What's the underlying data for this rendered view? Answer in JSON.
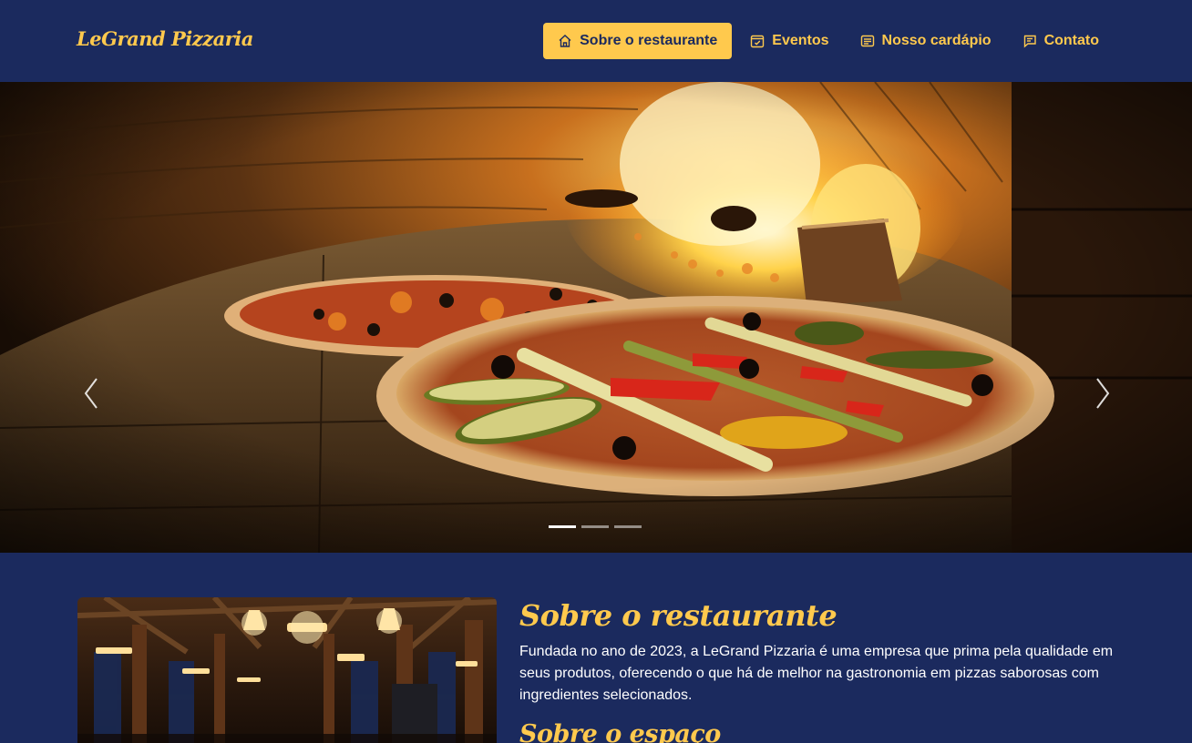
{
  "brand": "LeGrand Pizzaria",
  "nav": {
    "items": [
      {
        "label": "Sobre o restaurante",
        "icon": "home-icon",
        "active": true
      },
      {
        "label": "Eventos",
        "icon": "calendar-check-icon",
        "active": false
      },
      {
        "label": "Nosso cardápio",
        "icon": "menu-card-icon",
        "active": false
      },
      {
        "label": "Contato",
        "icon": "chat-icon",
        "active": false
      }
    ]
  },
  "carousel": {
    "slide_description": "Pizzas in wood-fired oven",
    "slide_count": 3,
    "active_slide": 1
  },
  "about": {
    "title": "Sobre o restaurante",
    "text": "Fundada no ano de 2023, a LeGrand Pizzaria é uma empresa que prima pela qualidade em seus produtos, oferecendo o que há de melhor na gastronomia em pizzas saborosas com ingredientes selecionados.",
    "subtitle": "Sobre o espaço"
  },
  "colors": {
    "navy": "#1b2a5e",
    "accent": "#ffc94d",
    "text": "#ffffff"
  }
}
